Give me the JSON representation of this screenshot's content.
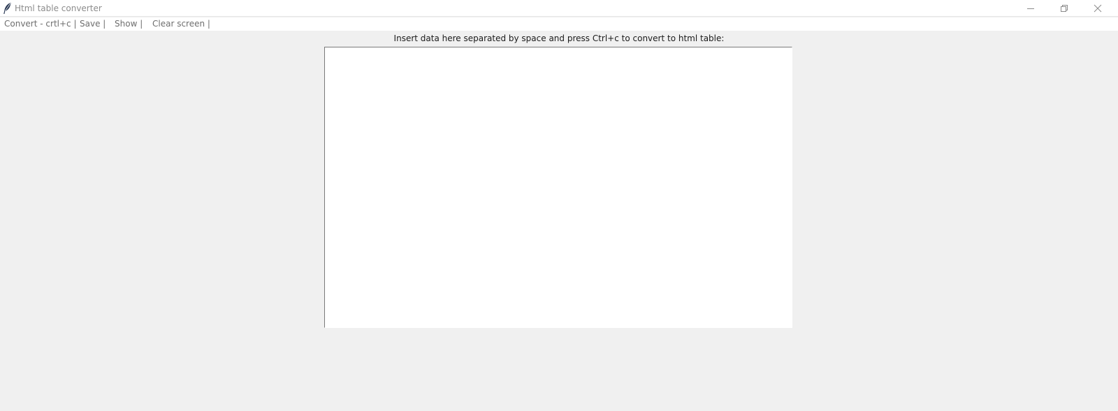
{
  "window": {
    "title": "Html table converter",
    "icon": "feather-icon"
  },
  "titlebar_controls": {
    "minimize_icon": "minimize-icon",
    "maximize_icon": "restore-icon",
    "close_icon": "close-icon"
  },
  "menu": {
    "items": [
      {
        "label": "Convert - crtl+c |"
      },
      {
        "label": "Save |"
      },
      {
        "label": "Show |"
      },
      {
        "label": "Clear screen |"
      }
    ]
  },
  "main": {
    "prompt": "Insert data here separated by space and press Ctrl+c to convert to html table:",
    "input_value": ""
  },
  "colors": {
    "background": "#f0f0f0",
    "titlebar": "#ffffff",
    "menu_text": "#6e6e6e",
    "textarea": "#ffffff"
  }
}
